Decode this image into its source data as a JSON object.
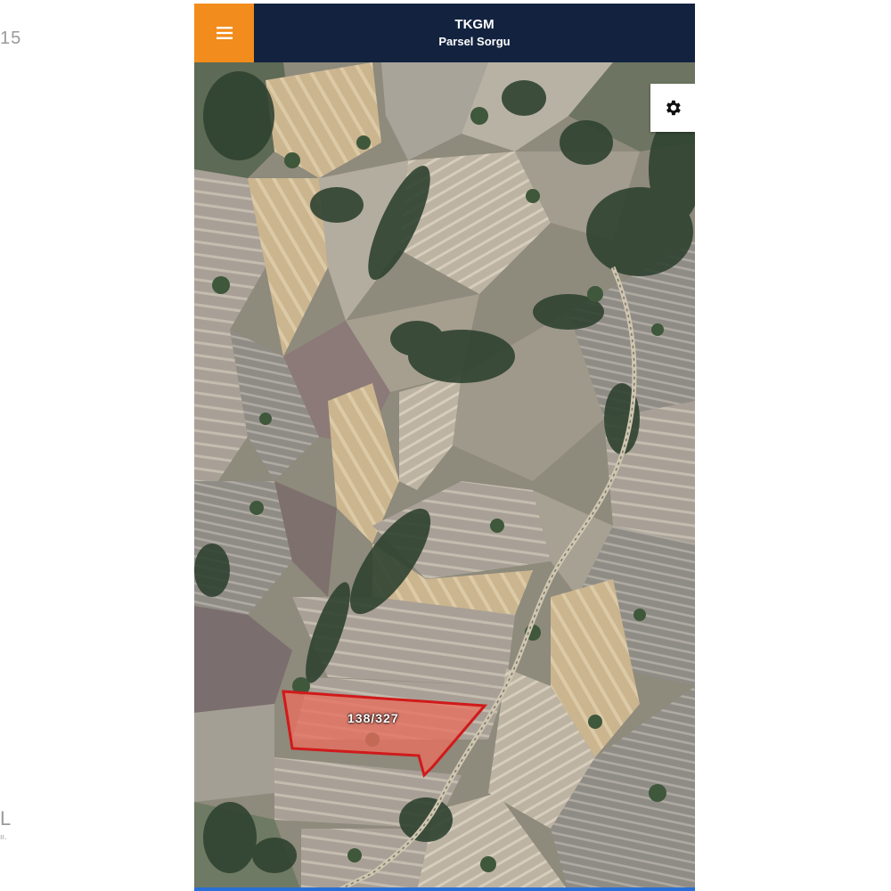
{
  "edge": {
    "top_text": "15",
    "bottom_text": "L",
    "bottom_small": "ıı."
  },
  "header": {
    "title": "TKGM",
    "subtitle": "Parsel Sorgu",
    "menu_icon": "hamburger-icon"
  },
  "map": {
    "settings_icon": "gear-icon",
    "parcel_label": "138/327"
  },
  "colors": {
    "header_bg": "#13233f",
    "menu_bg": "#f28c1c",
    "parcel_fill": "#e8705f",
    "parcel_stroke": "#d01a1a"
  }
}
